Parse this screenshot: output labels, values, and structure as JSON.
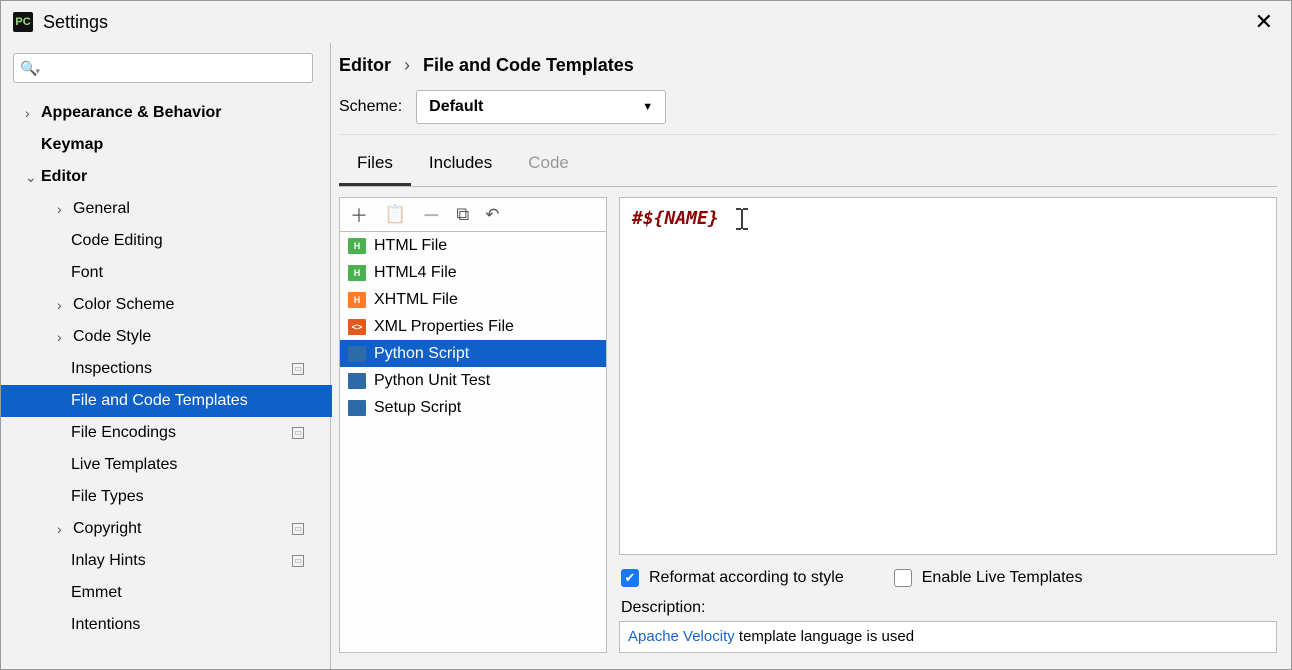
{
  "window": {
    "title": "Settings"
  },
  "search": {
    "placeholder": ""
  },
  "sidebar": {
    "appearance": "Appearance & Behavior",
    "keymap": "Keymap",
    "editor": "Editor",
    "general": "General",
    "code_editing": "Code Editing",
    "font": "Font",
    "color_scheme": "Color Scheme",
    "code_style": "Code Style",
    "inspections": "Inspections",
    "file_code_templates": "File and Code Templates",
    "file_encodings": "File Encodings",
    "live_templates": "Live Templates",
    "file_types": "File Types",
    "copyright": "Copyright",
    "inlay_hints": "Inlay Hints",
    "emmet": "Emmet",
    "intentions": "Intentions"
  },
  "breadcrumb": {
    "parent": "Editor",
    "current": "File and Code Templates"
  },
  "scheme": {
    "label": "Scheme:",
    "value": "Default"
  },
  "tabs": {
    "files": "Files",
    "includes": "Includes",
    "code": "Code"
  },
  "templates": [
    {
      "label": "HTML File",
      "color": "ic-green",
      "letter": "H"
    },
    {
      "label": "HTML4 File",
      "color": "ic-green",
      "letter": "H"
    },
    {
      "label": "XHTML File",
      "color": "ic-orange",
      "letter": "H"
    },
    {
      "label": "XML Properties File",
      "color": "ic-orange2",
      "letter": "<>"
    },
    {
      "label": "Python Script",
      "color": "ic-py",
      "letter": "🐍"
    },
    {
      "label": "Python Unit Test",
      "color": "ic-py",
      "letter": "🐍"
    },
    {
      "label": "Setup Script",
      "color": "ic-py",
      "letter": "🐍"
    }
  ],
  "editor_content": "#${NAME}",
  "checks": {
    "reformat": "Reformat according to style",
    "enable_live": "Enable Live Templates"
  },
  "description": {
    "label": "Description:",
    "link": "Apache Velocity",
    "rest": " template language is used"
  }
}
